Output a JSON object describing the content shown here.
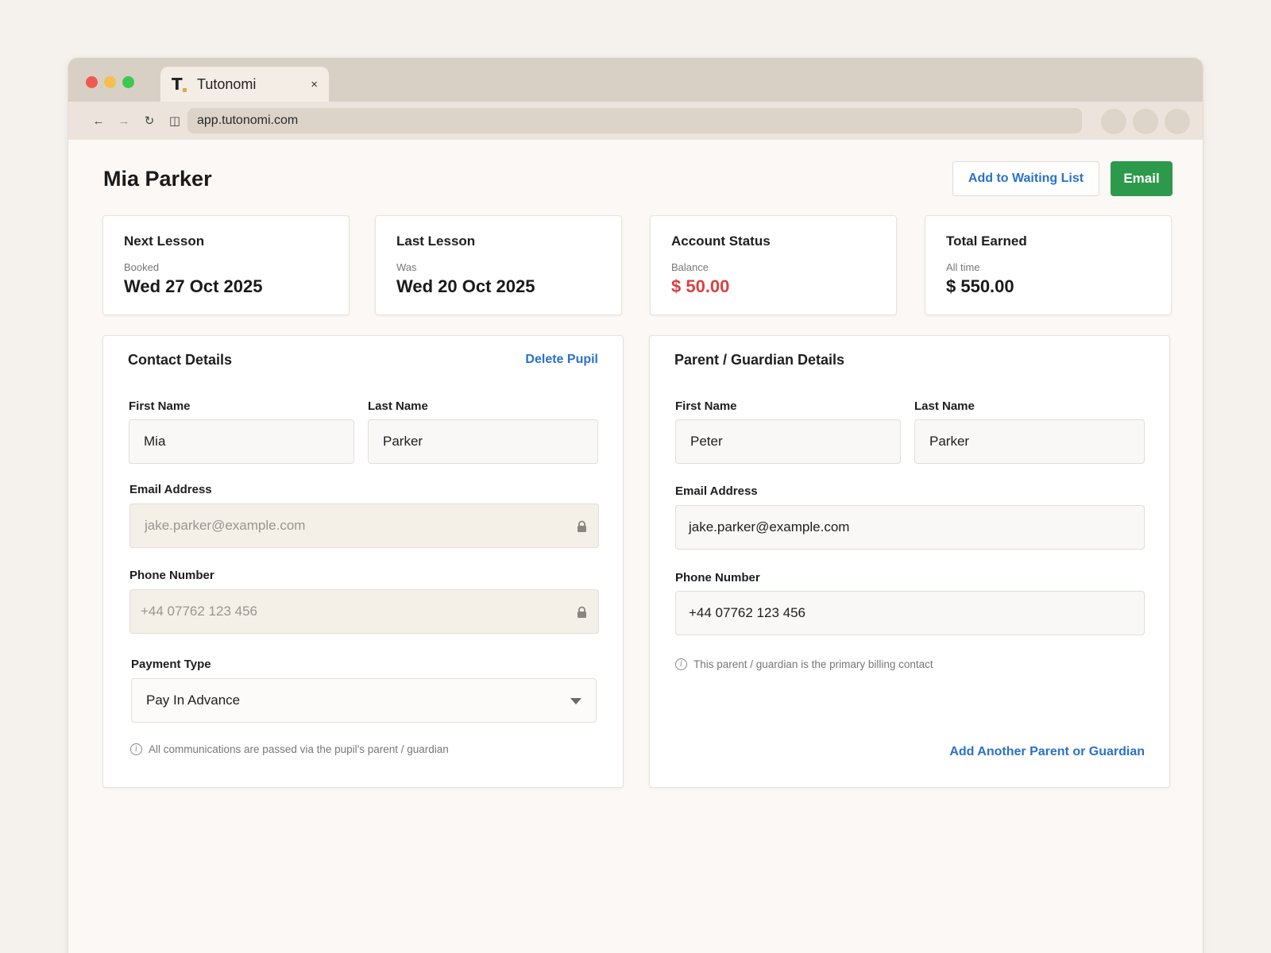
{
  "browser": {
    "tab_title": "Tutonomi",
    "tab_logo": "T",
    "tab_close": "×",
    "url": "app.tutonomi.com",
    "nav": {
      "back": "←",
      "forward": "→",
      "reload": "↻",
      "reader": "◫"
    }
  },
  "header": {
    "title": "Mia Parker",
    "waiting_list_label": "Add to Waiting List",
    "email_label": "Email"
  },
  "stats": [
    {
      "title": "Next Lesson",
      "sub": "Booked",
      "value": "Wed 27 Oct 2025"
    },
    {
      "title": "Last Lesson",
      "sub": "Was",
      "value": "Wed 20 Oct 2025"
    },
    {
      "title": "Account Status",
      "sub": "Balance",
      "value": "$ 50.00"
    },
    {
      "title": "Total Earned",
      "sub": "All time",
      "value": "$ 550.00"
    }
  ],
  "contact": {
    "title": "Contact Details",
    "delete_label": "Delete Pupil",
    "first_name_label": "First Name",
    "first_name": "Mia",
    "last_name_label": "Last Name",
    "last_name": "Parker",
    "email_label": "Email Address",
    "email": "jake.parker@example.com",
    "phone_label": "Phone Number",
    "phone": "+44 07762 123 456",
    "payment_label": "Payment Type",
    "payment": "Pay In Advance",
    "note": "All communications are passed via the pupil's parent / guardian"
  },
  "guardian": {
    "title": "Parent / Guardian Details",
    "first_name_label": "First Name",
    "first_name": "Peter",
    "last_name_label": "Last Name",
    "last_name": "Parker",
    "email_label": "Email Address",
    "email": "jake.parker@example.com",
    "phone_label": "Phone Number",
    "phone": "+44 07762 123 456",
    "note": "This parent / guardian is the primary billing contact",
    "add_label": "Add Another Parent or Guardian"
  },
  "icons": {
    "info": "i"
  },
  "colors": {
    "accent_blue": "#2a71c9",
    "accent_green": "#2d9a4b",
    "balance_red": "#d94141"
  }
}
